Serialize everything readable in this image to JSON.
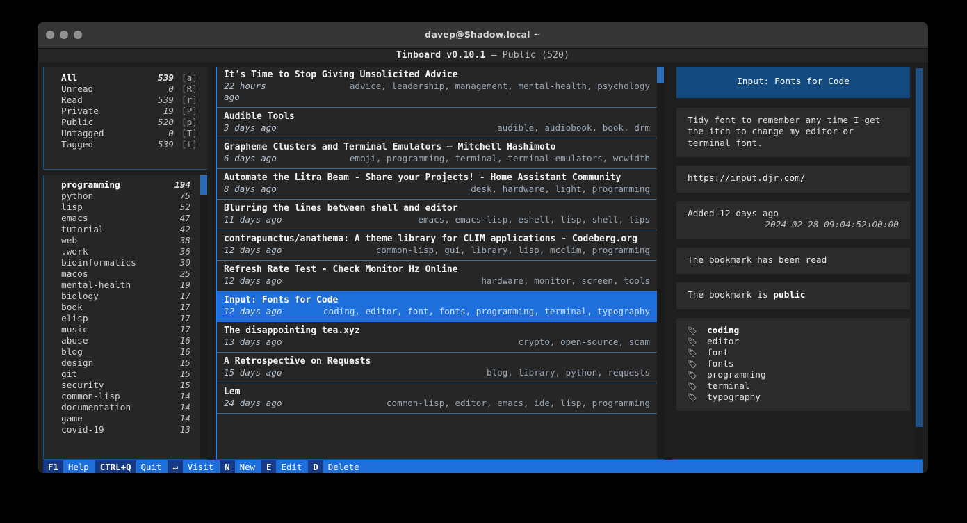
{
  "window": {
    "title": "davep@Shadow.local ~",
    "traffic_lights": [
      "close-dot",
      "minimize-dot",
      "zoom-dot"
    ]
  },
  "app": {
    "name": "Tinboard",
    "version": "v0.10.1",
    "separator": "—",
    "scope": "Public",
    "scope_count": "(520)"
  },
  "filters": [
    {
      "label": "All",
      "count": "539",
      "key": "[a]",
      "selected": true
    },
    {
      "label": "Unread",
      "count": "0",
      "key": "[R]",
      "selected": false
    },
    {
      "label": "Read",
      "count": "539",
      "key": "[r]",
      "selected": false
    },
    {
      "label": "Private",
      "count": "19",
      "key": "[P]",
      "selected": false
    },
    {
      "label": "Public",
      "count": "520",
      "key": "[p]",
      "selected": false
    },
    {
      "label": "Untagged",
      "count": "0",
      "key": "[T]",
      "selected": false
    },
    {
      "label": "Tagged",
      "count": "539",
      "key": "[t]",
      "selected": false
    }
  ],
  "tags": [
    {
      "label": "programming",
      "count": "194",
      "selected": true
    },
    {
      "label": "python",
      "count": "75",
      "selected": false
    },
    {
      "label": "lisp",
      "count": "52",
      "selected": false
    },
    {
      "label": "emacs",
      "count": "47",
      "selected": false
    },
    {
      "label": "tutorial",
      "count": "42",
      "selected": false
    },
    {
      "label": "web",
      "count": "38",
      "selected": false
    },
    {
      "label": ".work",
      "count": "36",
      "selected": false
    },
    {
      "label": "bioinformatics",
      "count": "30",
      "selected": false
    },
    {
      "label": "macos",
      "count": "25",
      "selected": false
    },
    {
      "label": "mental-health",
      "count": "19",
      "selected": false
    },
    {
      "label": "biology",
      "count": "17",
      "selected": false
    },
    {
      "label": "book",
      "count": "17",
      "selected": false
    },
    {
      "label": "elisp",
      "count": "17",
      "selected": false
    },
    {
      "label": "music",
      "count": "17",
      "selected": false
    },
    {
      "label": "abuse",
      "count": "16",
      "selected": false
    },
    {
      "label": "blog",
      "count": "16",
      "selected": false
    },
    {
      "label": "design",
      "count": "15",
      "selected": false
    },
    {
      "label": "git",
      "count": "15",
      "selected": false
    },
    {
      "label": "security",
      "count": "15",
      "selected": false
    },
    {
      "label": "common-lisp",
      "count": "14",
      "selected": false
    },
    {
      "label": "documentation",
      "count": "14",
      "selected": false
    },
    {
      "label": "game",
      "count": "14",
      "selected": false
    },
    {
      "label": "covid-19",
      "count": "13",
      "selected": false
    }
  ],
  "bookmarks": [
    {
      "title": "It's Time to Stop Giving Unsolicited Advice",
      "date": "22 hours ago",
      "tags": "advice, leadership, management, mental-health, psychology",
      "selected": false
    },
    {
      "title": "Audible Tools",
      "date": "3 days ago",
      "tags": "audible, audiobook, book, drm",
      "selected": false
    },
    {
      "title": "Grapheme Clusters and Terminal Emulators — Mitchell Hashimoto",
      "date": "6 days ago",
      "tags": "emoji, programming, terminal, terminal-emulators, wcwidth",
      "selected": false
    },
    {
      "title": "Automate the Litra Beam - Share your Projects! - Home Assistant Community",
      "date": "8 days ago",
      "tags": "desk, hardware, light, programming",
      "selected": false
    },
    {
      "title": "Blurring the lines between shell and editor",
      "date": "11 days ago",
      "tags": "emacs, emacs-lisp, eshell, lisp, shell, tips",
      "selected": false
    },
    {
      "title": "contrapunctus/anathema: A theme library for CLIM applications - Codeberg.org",
      "date": "12 days ago",
      "tags": "common-lisp, gui, library, lisp, mcclim, programming",
      "selected": false
    },
    {
      "title": "Refresh Rate Test - Check Monitor Hz Online",
      "date": "12 days ago",
      "tags": "hardware, monitor, screen, tools",
      "selected": false
    },
    {
      "title": "Input: Fonts for Code",
      "date": "12 days ago",
      "tags": "coding, editor, font, fonts, programming, terminal, typography",
      "selected": true
    },
    {
      "title": "The disappointing tea.xyz",
      "date": "13 days ago",
      "tags": "crypto, open-source, scam",
      "selected": false
    },
    {
      "title": "A Retrospective on Requests",
      "date": "15 days ago",
      "tags": "blog, library, python, requests",
      "selected": false
    },
    {
      "title": "Lem",
      "date": "24 days ago",
      "tags": "common-lisp, editor, emacs, ide, lisp, programming",
      "selected": false
    }
  ],
  "details": {
    "header": "Input: Fonts for Code",
    "description": "Tidy font to remember any time I get the itch to change my editor or terminal font.",
    "url": "https://input.djr.com/",
    "added_label": "Added 12 days ago",
    "added_timestamp": "2024-02-28 09:04:52+00:00",
    "read_status": "The bookmark has been read",
    "visibility_prefix": "The bookmark is ",
    "visibility_value": "public",
    "tags": [
      {
        "label": "coding"
      },
      {
        "label": "editor"
      },
      {
        "label": "font"
      },
      {
        "label": "fonts"
      },
      {
        "label": "programming"
      },
      {
        "label": "terminal"
      },
      {
        "label": "typography"
      }
    ],
    "tag_bullet": "🏷"
  },
  "footer": [
    {
      "key": "F1",
      "label": "Help"
    },
    {
      "key": "CTRL+Q",
      "label": "Quit"
    },
    {
      "key": "↵",
      "label": "Visit"
    },
    {
      "key": "N",
      "label": "New"
    },
    {
      "key": "E",
      "label": "Edit"
    },
    {
      "key": "D",
      "label": "Delete"
    }
  ],
  "colors": {
    "accent_blue": "#1e6fd9",
    "panel_border": "#1f4e79",
    "focus_border": "#2d7ff0",
    "panel_bg": "#262626",
    "header_blue": "#134a80",
    "footer_key_bg": "#163a85"
  }
}
